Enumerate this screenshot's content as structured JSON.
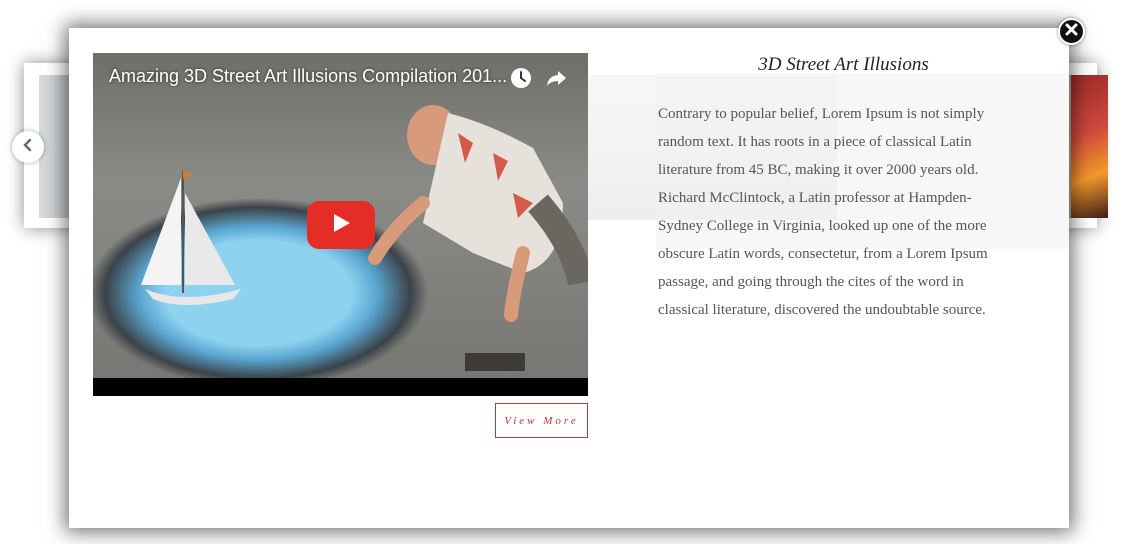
{
  "modal": {
    "title": "3D Street Art Illusions",
    "body": "Contrary to popular belief, Lorem Ipsum is not simply random text. It has roots in a piece of classical Latin literature from 45 BC, making it over 2000 years old. Richard McClintock, a Latin professor at Hampden-Sydney College in Virginia, looked up one of the more obscure Latin words, consectetur, from a Lorem Ipsum passage, and going through the cites of the word in classical literature, discovered the undoubtable source.",
    "view_more_label": "View More",
    "close_icon": "close-icon"
  },
  "video": {
    "title": "Amazing 3D Street Art Illusions Compilation 201...",
    "icons": [
      "clock-icon",
      "share-icon",
      "play-icon"
    ],
    "play_color": "#e52d27"
  },
  "carousel": {
    "prev_icon": "chevron-left-icon"
  },
  "colors": {
    "accent": "#b33a3a",
    "text": "#555555"
  }
}
